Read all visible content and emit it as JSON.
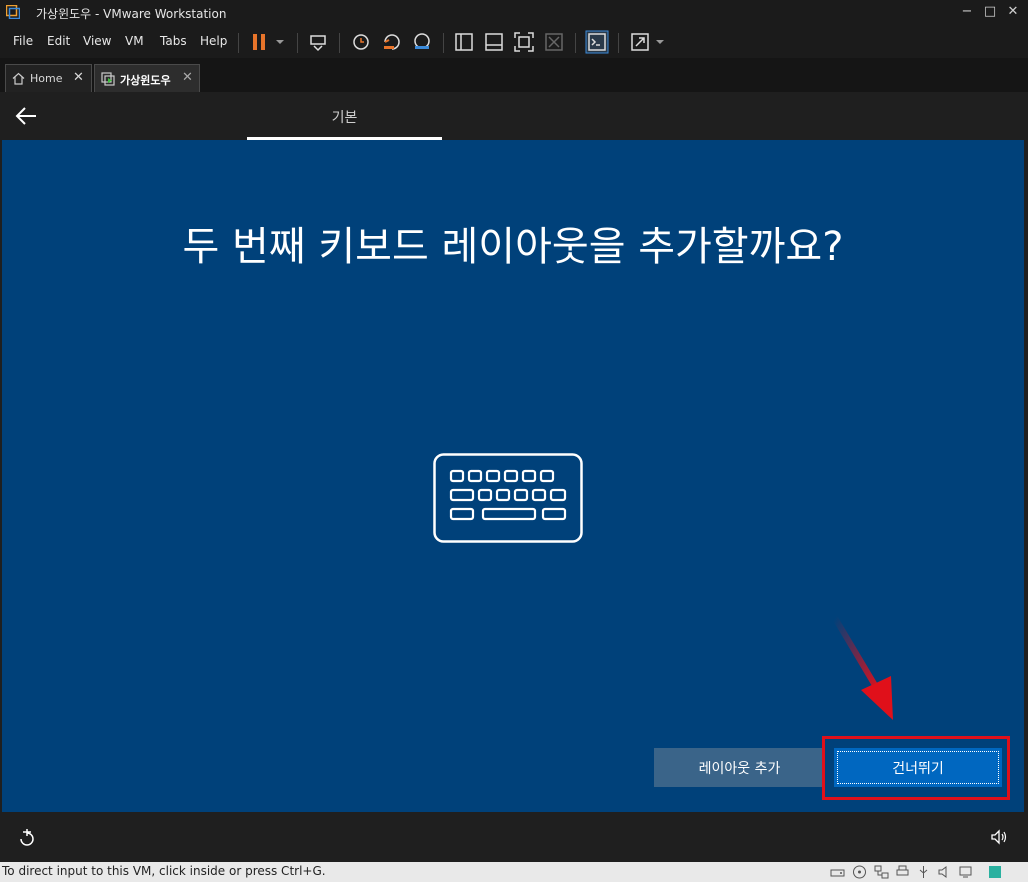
{
  "window": {
    "title": "가상윈도우 - VMware Workstation",
    "accent": "#e8742a"
  },
  "window_controls": {
    "minimize": "−",
    "maximize": "□",
    "close": "✕"
  },
  "menu": [
    "File",
    "Edit",
    "View",
    "VM",
    "Tabs",
    "Help"
  ],
  "tabs": [
    {
      "label": "Home",
      "icon": "home-icon",
      "close": "✕"
    },
    {
      "label": "가상윈도우",
      "icon": "vm-icon",
      "close": "✕",
      "active": true
    }
  ],
  "oobe": {
    "section_tab": "기본",
    "headline": "두 번째 키보드 레이아웃을 추가할까요?",
    "keyboard_icon": "keyboard-icon",
    "buttons": {
      "add_layout": "레이아웃 추가",
      "skip": "건너뛰기"
    },
    "colors": {
      "background": "#00417a",
      "primary_button": "#0067c0",
      "secondary_button": "#3a6489",
      "highlight": "#e0101a"
    }
  },
  "statusbar": {
    "text": "To direct input to this VM, click inside or press Ctrl+G."
  }
}
